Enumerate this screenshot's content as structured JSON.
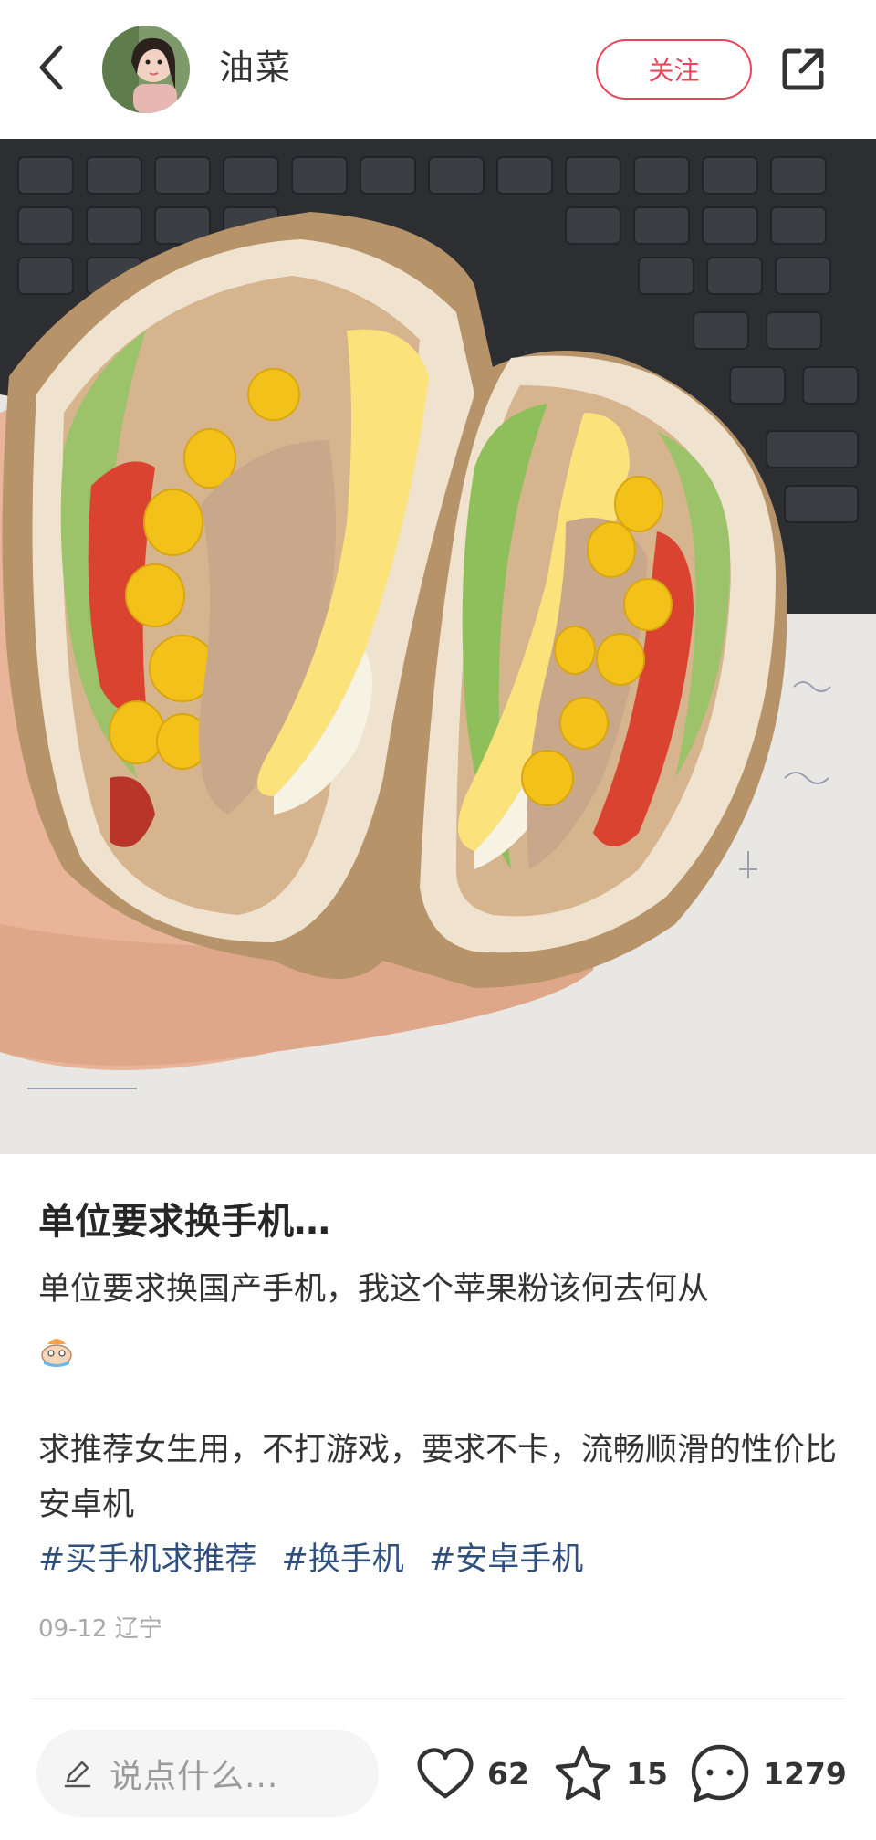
{
  "header": {
    "author_name": "油菜",
    "follow_label": "关注",
    "icons": {
      "back": "chevron-left-icon",
      "share": "share-icon"
    }
  },
  "note": {
    "title": "单位要求换手机…",
    "body_line1": "单位要求换国产手机，我这个苹果粉该何去何从",
    "emoji": "crying-emoji",
    "body_line2": "求推荐女生用，不打游戏，要求不卡，流畅顺滑的性价比安卓机",
    "tags": [
      "#买手机求推荐",
      "#换手机",
      "#安卓手机"
    ],
    "date": "09-12",
    "location": "辽宁"
  },
  "bottom_bar": {
    "comment_placeholder": "说点什么...",
    "likes": "62",
    "favorites": "15",
    "comments": "1279",
    "icons": {
      "pen": "pen-icon",
      "like": "heart-icon",
      "favorite": "star-icon",
      "comment": "comment-bubble-icon"
    }
  },
  "colors": {
    "accent": "#e8475a",
    "tag": "#2f4f7f",
    "meta": "#a8a8a8"
  }
}
